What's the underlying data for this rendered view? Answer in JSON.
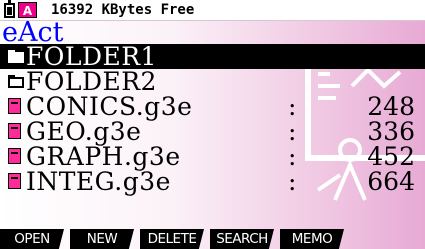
{
  "status": {
    "free_text": "16392 KBytes Free",
    "battery_icon": "battery-icon",
    "alpha_indicator": "A",
    "alpha_color": "#f00088"
  },
  "title": "eAct",
  "title_color": "#0000ff",
  "items": [
    {
      "type": "folder",
      "name": "FOLDER1",
      "selected": true
    },
    {
      "type": "folder",
      "name": "FOLDER2",
      "selected": false
    },
    {
      "type": "file",
      "name": "CONICS.g3e",
      "sep": ":",
      "size": "248"
    },
    {
      "type": "file",
      "name": "GEO.g3e",
      "sep": ":",
      "size": "336"
    },
    {
      "type": "file",
      "name": "GRAPH.g3e",
      "sep": ":",
      "size": "452"
    },
    {
      "type": "file",
      "name": "INTEG.g3e",
      "sep": ":",
      "size": "664"
    }
  ],
  "function_keys": [
    "OPEN",
    "NEW",
    "DELETE",
    "SEARCH",
    "MEMO"
  ],
  "file_icon_color": "#ff2b9a"
}
